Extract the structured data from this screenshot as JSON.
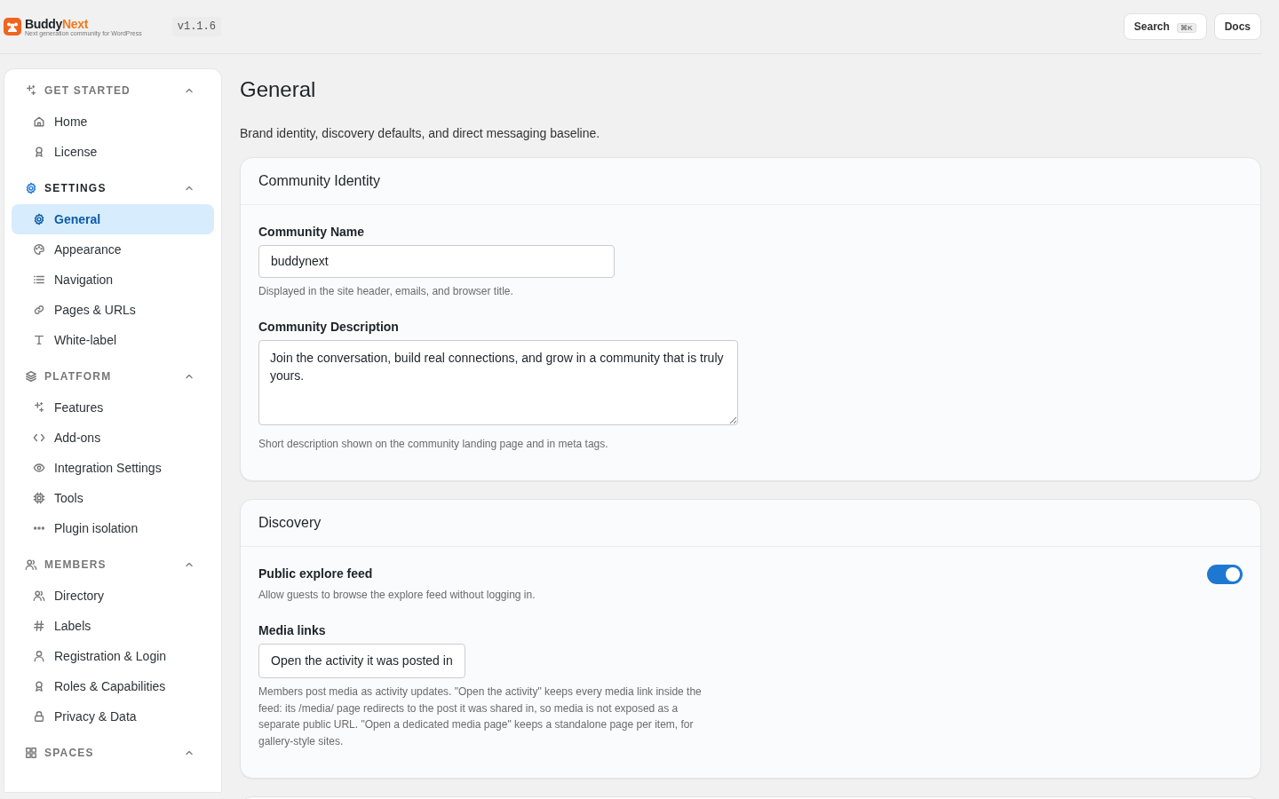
{
  "header": {
    "logo": {
      "name_dark": "Buddy",
      "name_accent": "Next",
      "tagline": "Next generation community for WordPress"
    },
    "version": "v1.1.6",
    "buttons": [
      {
        "kind": "search",
        "label": "Search",
        "shortcut": "⌘K"
      },
      {
        "kind": "plain",
        "label": "Docs"
      }
    ]
  },
  "sidebar": {
    "sections": [
      {
        "title": "GET STARTED",
        "active": false,
        "expanded": true,
        "items": [
          {
            "label": "Home",
            "selected": false
          },
          {
            "label": "License",
            "selected": false
          }
        ]
      },
      {
        "title": "SETTINGS",
        "active": true,
        "expanded": true,
        "items": [
          {
            "label": "General",
            "selected": true
          },
          {
            "label": "Appearance",
            "selected": false
          },
          {
            "label": "Navigation",
            "selected": false
          },
          {
            "label": "Pages & URLs",
            "selected": false
          },
          {
            "label": "White-label",
            "selected": false
          }
        ]
      },
      {
        "title": "PLATFORM",
        "active": false,
        "expanded": true,
        "items": [
          {
            "label": "Features",
            "selected": false
          },
          {
            "label": "Add-ons",
            "selected": false
          },
          {
            "label": "Integration Settings",
            "selected": false
          },
          {
            "label": "Tools",
            "selected": false
          },
          {
            "label": "Plugin isolation",
            "selected": false
          }
        ]
      },
      {
        "title": "MEMBERS",
        "active": false,
        "expanded": true,
        "items": [
          {
            "label": "Directory",
            "selected": false
          },
          {
            "label": "Labels",
            "selected": false
          },
          {
            "label": "Registration & Login",
            "selected": false
          },
          {
            "label": "Roles & Capabilities",
            "selected": false
          },
          {
            "label": "Privacy & Data",
            "selected": false
          }
        ]
      },
      {
        "title": "SPACES",
        "active": false,
        "expanded": true
      }
    ]
  },
  "page": {
    "title": "General",
    "description": "Brand identity, discovery defaults, and direct messaging baseline.",
    "cards": [
      {
        "title": "Community Identity",
        "fields": [
          {
            "kind": "text",
            "label": "Community Name",
            "value": "buddynext",
            "help": "Displayed in the site header, emails, and browser title."
          },
          {
            "kind": "textarea",
            "label": "Community Description",
            "value": "Join the conversation, build real connections, and grow in a community that is truly yours.",
            "help": "Short description shown on the community landing page and in meta tags."
          }
        ]
      },
      {
        "title": "Discovery",
        "fields": [
          {
            "kind": "toggle",
            "label": "Public explore feed",
            "on": true,
            "help": "Allow guests to browse the explore feed without logging in."
          },
          {
            "kind": "select",
            "label": "Media links",
            "value": "Open the activity it was posted in",
            "help": "Members post media as activity updates. \"Open the activity\" keeps every media link inside the feed: its /media/ page redirects to the post it was shared in, so media is not exposed as a separate public URL. \"Open a dedicated media page\" keeps a standalone page per item, for gallery-style sites."
          }
        ]
      },
      {
        "kind": "empty"
      }
    ]
  }
}
